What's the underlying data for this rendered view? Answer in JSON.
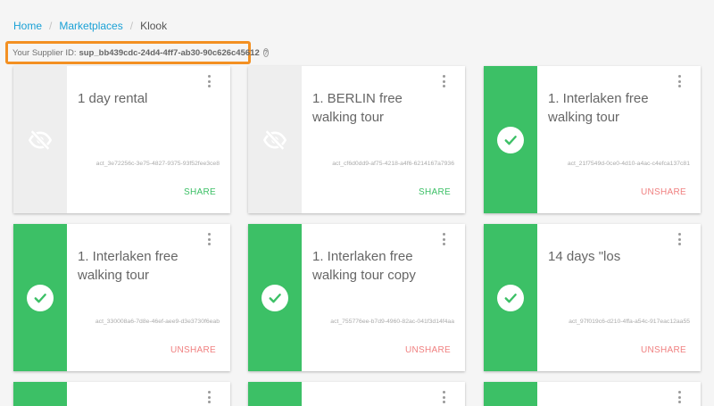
{
  "breadcrumb": {
    "home": "Home",
    "marketplaces": "Marketplaces",
    "current": "Klook"
  },
  "supplier": {
    "label": "Your Supplier ID:",
    "id": "sup_bb439cdc-24d4-4ff7-ab30-90c626c45612",
    "help_glyph": "?"
  },
  "colors": {
    "active_green": "#3cc066",
    "inactive_gray": "#eeeeee",
    "share_green": "#3cc066",
    "unshare_red": "#f08080",
    "link_blue": "#1aa1d6",
    "highlight_orange": "#f39022"
  },
  "cards": [
    {
      "title": "1 day rental",
      "act_id": "act_3e72256c-3e75-4827-9375-93f52fee3ce8",
      "action": "SHARE",
      "status": "hidden",
      "icon": "eye-off-icon"
    },
    {
      "title": "1. BERLIN free walking tour",
      "act_id": "act_cf6d0dd9-af75-4218-a4f6-6214167a7936",
      "action": "SHARE",
      "status": "hidden",
      "icon": "eye-off-icon"
    },
    {
      "title": "1. Interlaken free walking tour",
      "act_id": "act_21f7549d-0ce0-4d10-a4ac-c4efca137c81",
      "action": "UNSHARE",
      "status": "shared",
      "icon": "check-icon"
    },
    {
      "title": "1. Interlaken free walking tour",
      "act_id": "act_330008a6-7d8e-46ef-aee9-d3e3730f6eab",
      "action": "UNSHARE",
      "status": "shared",
      "icon": "check-icon"
    },
    {
      "title": "1. Interlaken free walking tour copy",
      "act_id": "act_755776ee-b7d9-4960-82ac-041f3d14f4aa",
      "action": "UNSHARE",
      "status": "shared",
      "icon": "check-icon"
    },
    {
      "title": "14 days \"los",
      "act_id": "act_97f019c6-d210-4ffa-a54c-917eac12aa55",
      "action": "UNSHARE",
      "status": "shared",
      "icon": "check-icon"
    }
  ]
}
